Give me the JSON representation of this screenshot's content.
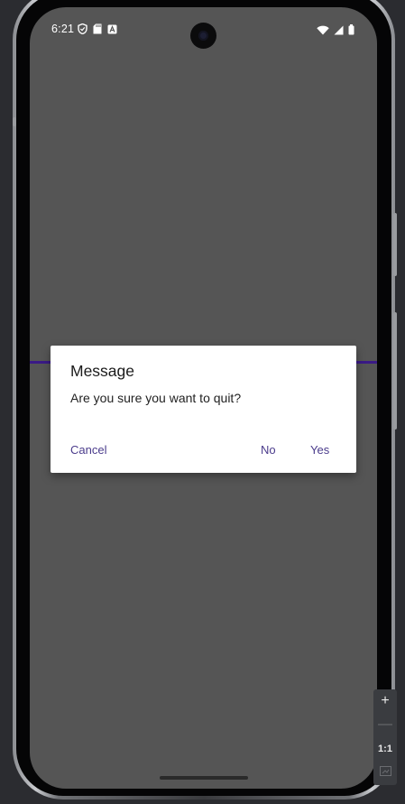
{
  "status_bar": {
    "time": "6:21",
    "left_icons": [
      "shield-icon",
      "sd-card-icon",
      "a-icon"
    ],
    "right_icons": [
      "wifi-icon",
      "signal-icon",
      "battery-icon"
    ]
  },
  "dialog": {
    "title": "Message",
    "message": "Are you sure you want to quit?",
    "cancel_label": "Cancel",
    "no_label": "No",
    "yes_label": "Yes"
  },
  "zoom_toolbar": {
    "zoom_in": "+",
    "zoom_out": "—",
    "actual_size": "1:1",
    "fit_icon": "fit-screen-icon"
  },
  "colors": {
    "screen_bg": "#555555",
    "accent": "#3a1a86",
    "dialog_button": "#4b3c8c",
    "emulator_bg": "#2b2c30"
  }
}
